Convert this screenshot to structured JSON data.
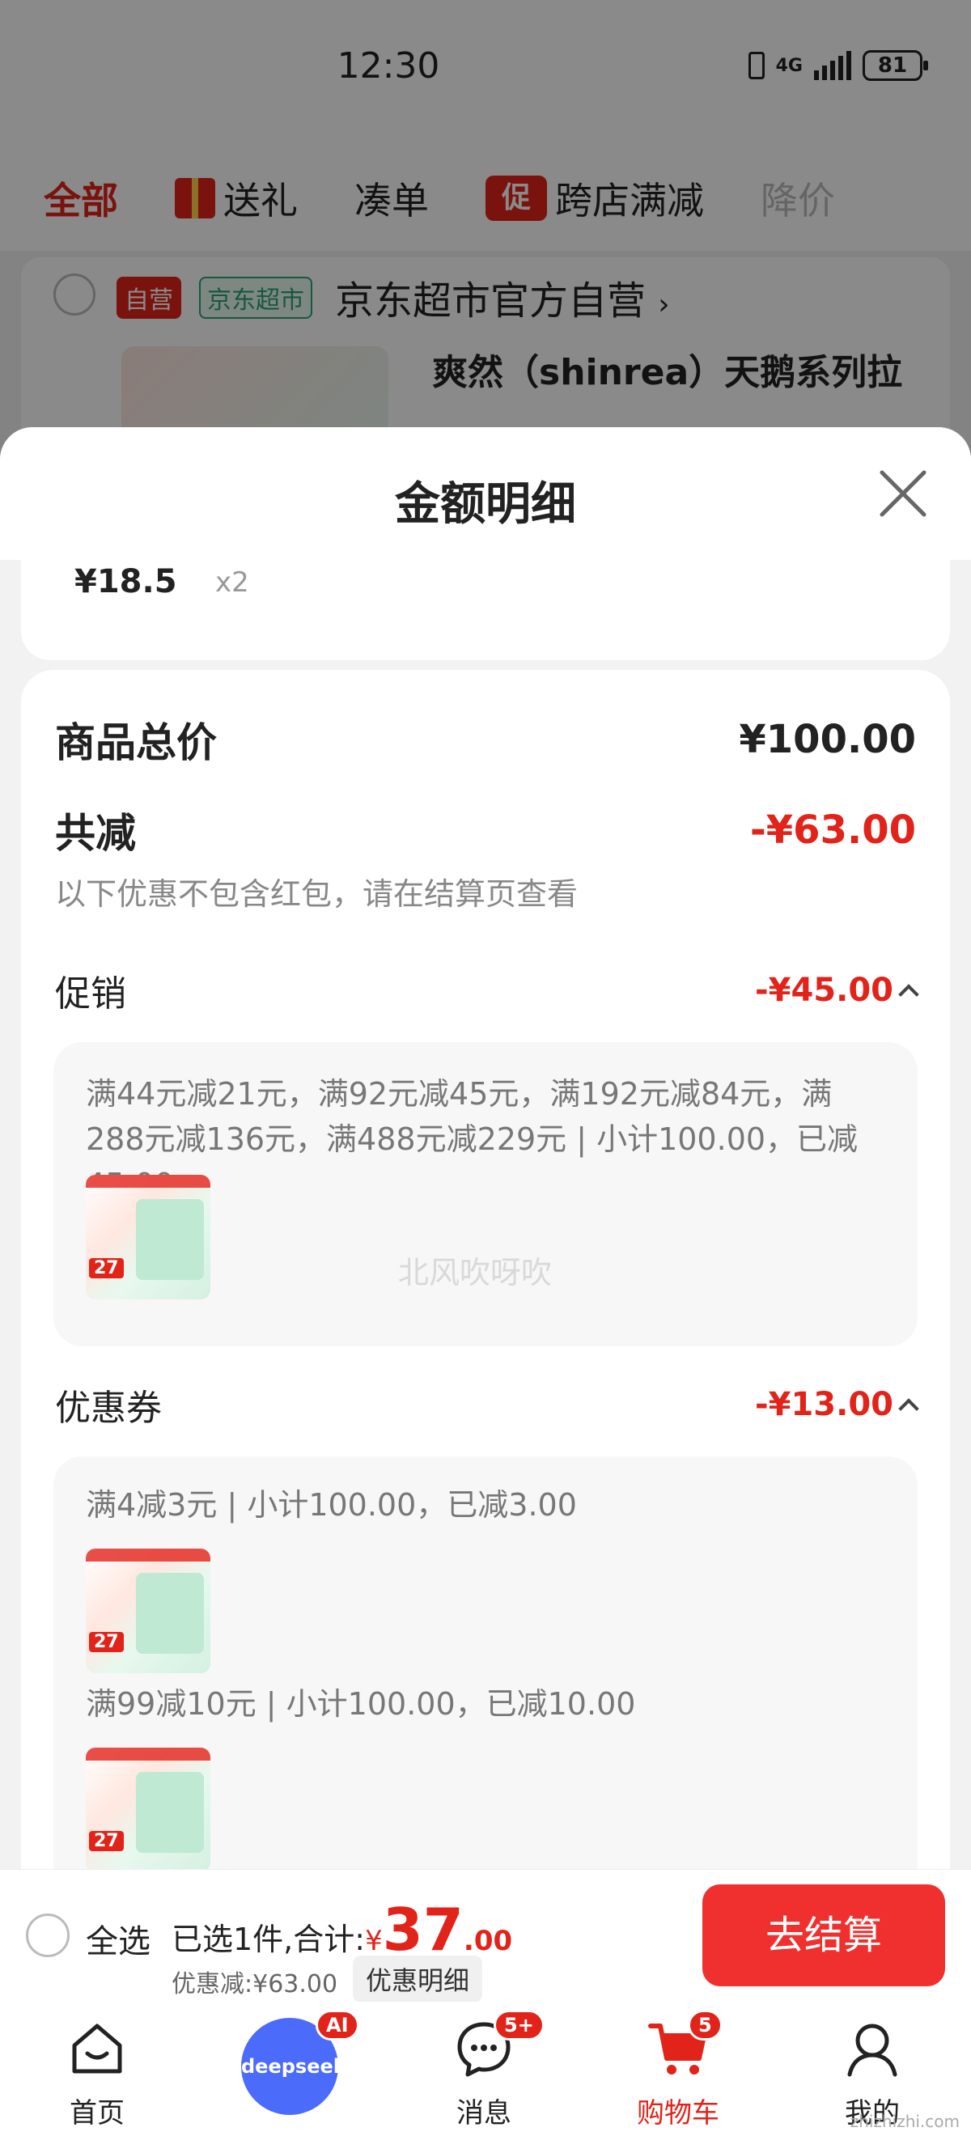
{
  "status_bar": {
    "time": "12:30",
    "network": "4G",
    "battery": "81"
  },
  "tabs": [
    {
      "label": "全部"
    },
    {
      "label": "送礼"
    },
    {
      "label": "凑单"
    },
    {
      "label": "跨店满减",
      "badge": "促"
    },
    {
      "label": "降价"
    }
  ],
  "store": {
    "self_badge": "自营",
    "channel_badge": "京东超市",
    "name": "京东超市官方自营",
    "product_title": "爽然（shinrea）天鹅系列拉"
  },
  "sheet": {
    "title": "金额明细",
    "prev_item": {
      "price": "¥18.5",
      "qty": "x2"
    },
    "total_label": "商品总价",
    "total_value": "¥100.00",
    "reduce_label": "共减",
    "reduce_value": "-¥63.00",
    "note": "以下优惠不包含红包，请在结算页查看",
    "promotion": {
      "label": "促销",
      "value": "-¥45.00",
      "rules": "满44元减21元，满92元减45元，满192元减84元，满288元减136元，满488元减229元 | 小计100.00，已减45.00"
    },
    "coupon": {
      "label": "优惠券",
      "value": "-¥13.00",
      "items": [
        {
          "text": "满4减3元 | 小计100.00，已减3.00"
        },
        {
          "text": "满99减10元 | 小计100.00，已减10.00"
        }
      ]
    },
    "watermark": "北风吹呀吹",
    "thumb_price_tag": "27"
  },
  "checkout": {
    "select_all": "全选",
    "selected_prefix": "已选1件,合计:",
    "currency": "¥",
    "total_int": "37",
    "total_dec": ".00",
    "discount": "优惠减:¥63.00",
    "detail_chip": "优惠明细",
    "button": "去结算"
  },
  "nav": [
    {
      "label": "首页",
      "icon": "home-icon"
    },
    {
      "label": "deepseek",
      "icon": "deepseek-icon",
      "badge": "AI"
    },
    {
      "label": "消息",
      "icon": "message-icon",
      "badge": "5+"
    },
    {
      "label": "购物车",
      "icon": "cart-icon",
      "badge": "5"
    },
    {
      "label": "我的",
      "icon": "user-icon"
    }
  ],
  "corner_watermark": "zhizhizhi.com",
  "colors": {
    "accent": "#e2231a",
    "button": "#f0302e",
    "green": "#2aa37a"
  }
}
